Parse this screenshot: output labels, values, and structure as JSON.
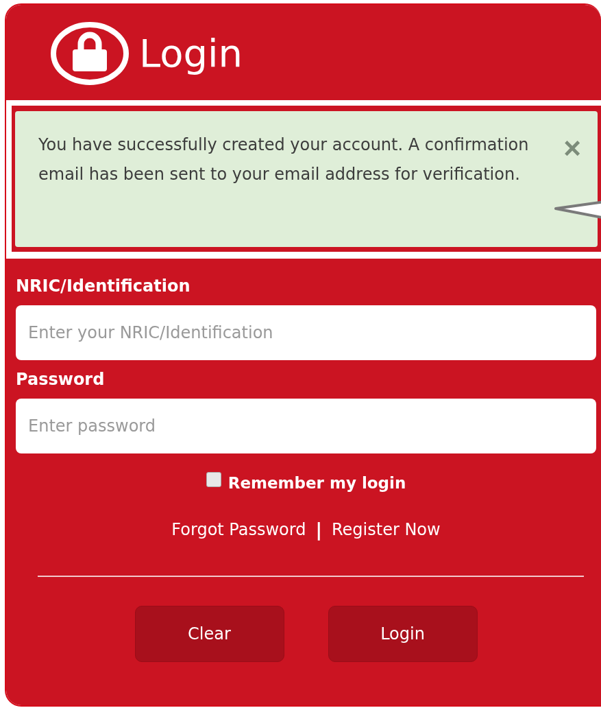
{
  "header": {
    "title": "Login"
  },
  "alert": {
    "message": "You have successfully created your account. A confirmation email has been sent to your email address for verification.",
    "close": "×"
  },
  "fields": [
    {
      "label": "NRIC/Identification",
      "placeholder": "Enter your NRIC/Identification"
    },
    {
      "label": "Password",
      "placeholder": "Enter password"
    }
  ],
  "remember": {
    "label": "Remember my login",
    "checked": false
  },
  "links": {
    "forgot": "Forgot Password",
    "separator": "|",
    "register": "Register Now"
  },
  "buttons": [
    "Clear",
    "Login"
  ]
}
